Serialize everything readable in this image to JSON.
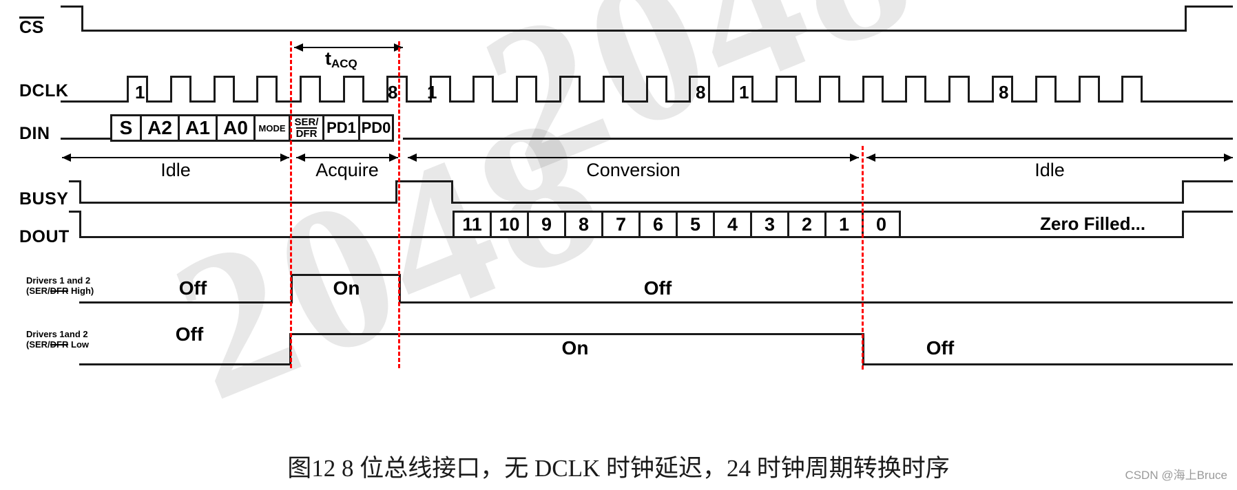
{
  "figure": {
    "caption": "图12 8 位总线接口，无 DCLK 时钟延迟，24 时钟周期转换时序",
    "credit": "CSDN @海上Bruce",
    "watermark_text": "2048"
  },
  "signals": {
    "cs": {
      "label": "CS",
      "overline": true
    },
    "dclk": {
      "label": "DCLK"
    },
    "din": {
      "label": "DIN"
    },
    "busy": {
      "label": "BUSY"
    },
    "dout": {
      "label": "DOUT"
    },
    "drivers_high": {
      "line1": "Drivers 1 and 2",
      "line2_a": "(SER/",
      "line2_b": "DFR",
      "line2_c": " High)"
    },
    "drivers_low": {
      "line1": "Drivers 1and 2",
      "line2_a": "(SER/",
      "line2_b": "DFR",
      "line2_c": " Low"
    }
  },
  "timing": {
    "tacq_label_main": "t",
    "tacq_label_sub": "ACQ"
  },
  "dclk_markers": {
    "group1_first": "1",
    "group1_last": "8",
    "group2_first": "1",
    "group2_last": "8",
    "group3_first": "1",
    "group3_last": "8"
  },
  "din_cells": [
    {
      "text": "S",
      "size": "big"
    },
    {
      "text": "A2",
      "size": "big"
    },
    {
      "text": "A1",
      "size": "big"
    },
    {
      "text": "A0",
      "size": "big"
    },
    {
      "text": "MODE",
      "size": "tiny"
    },
    {
      "text": "SER/DFR",
      "size": "two-line"
    },
    {
      "text": "PD1",
      "size": "mid"
    },
    {
      "text": "PD0",
      "size": "mid"
    }
  ],
  "din_serdfr": {
    "top": "SER/",
    "bottom": "DFR"
  },
  "phases": [
    {
      "label": "Idle"
    },
    {
      "label": "Acquire"
    },
    {
      "label": "Conversion"
    },
    {
      "label": "Idle"
    }
  ],
  "dout_bits": [
    "11",
    "10",
    "9",
    "8",
    "7",
    "6",
    "5",
    "4",
    "3",
    "2",
    "1",
    "0"
  ],
  "dout_tail": "Zero Filled...",
  "drivers_high_states": [
    {
      "label": "Off"
    },
    {
      "label": "On"
    },
    {
      "label": "Off"
    }
  ],
  "drivers_low_states": [
    {
      "label": "Off"
    },
    {
      "label": "On"
    },
    {
      "label": "Off"
    }
  ],
  "colors": {
    "line": "#1a1a1a",
    "marker": "#ff0000",
    "background": "#ffffff",
    "credit": "#9a9a9a"
  }
}
